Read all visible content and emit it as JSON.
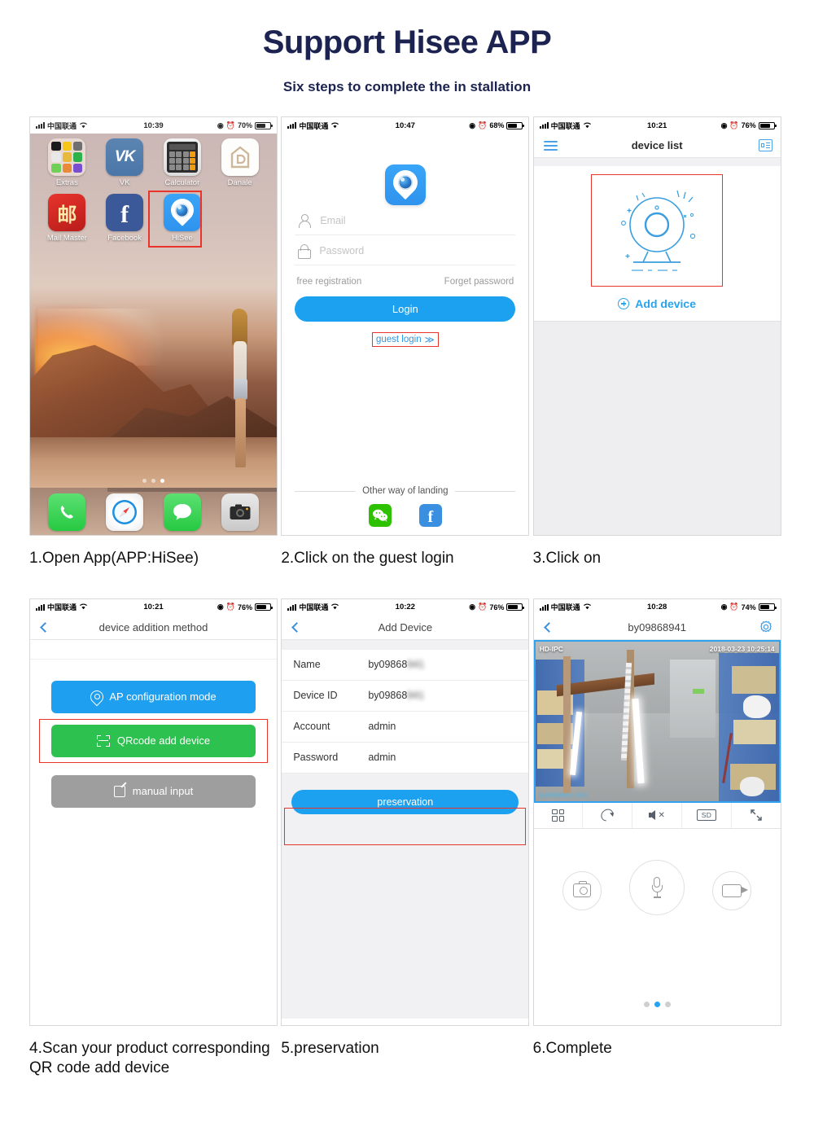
{
  "header": {
    "title": "Support Hisee APP",
    "subtitle": "Six steps to complete the in stallation"
  },
  "colors": {
    "title_navy": "#1c2350",
    "accent_blue": "#1ba1ef",
    "highlight_red": "#e8342a",
    "green": "#2dc14f",
    "gray_button": "#9e9e9e"
  },
  "steps": [
    {
      "caption": "1.Open App(APP:HiSee)"
    },
    {
      "caption": "2.Click on the guest login"
    },
    {
      "caption": "3.Click on"
    },
    {
      "caption": "4.Scan your product corresponding\n    QR code add device"
    },
    {
      "caption": "5.preservation"
    },
    {
      "caption": "6.Complete"
    }
  ],
  "phone1": {
    "status": {
      "carrier": "中国联通",
      "time": "10:39",
      "battery": "70%"
    },
    "apps": [
      {
        "label": "Extras",
        "icon": "folder-icon"
      },
      {
        "label": "VK",
        "icon": "vk-icon"
      },
      {
        "label": "Calculator",
        "icon": "calculator-icon"
      },
      {
        "label": "Danale",
        "icon": "danale-icon"
      },
      {
        "label": "Mail Master",
        "icon": "mail-master-icon"
      },
      {
        "label": "Facebook",
        "icon": "facebook-icon"
      },
      {
        "label": "HiSee",
        "icon": "hisee-icon"
      }
    ],
    "dock": [
      "phone-icon",
      "safari-icon",
      "messages-icon",
      "camera-icon"
    ]
  },
  "phone2": {
    "status": {
      "carrier": "中国联通",
      "time": "10:47",
      "battery": "68%"
    },
    "email_placeholder": "Email",
    "password_placeholder": "Password",
    "free_registration": "free registration",
    "forget_password": "Forget password",
    "login_label": "Login",
    "guest_login": "guest login",
    "guest_chevrons": "≫",
    "other_way": "Other way of landing",
    "socials": [
      "wechat-icon",
      "facebook-icon"
    ]
  },
  "phone3": {
    "status": {
      "carrier": "中国联通",
      "time": "10:21",
      "battery": "76%"
    },
    "nav_title": "device list",
    "add_device": "Add device"
  },
  "phone4": {
    "status": {
      "carrier": "中国联通",
      "time": "10:21",
      "battery": "76%"
    },
    "nav_title": "device addition method",
    "buttons": {
      "ap": "AP configuration mode",
      "qr": "QRcode add device",
      "manual": "manual input"
    }
  },
  "phone5": {
    "status": {
      "carrier": "中国联通",
      "time": "10:22",
      "battery": "76%"
    },
    "nav_title": "Add Device",
    "rows": [
      {
        "key": "Name",
        "value": "by09868",
        "blurred": "941"
      },
      {
        "key": "Device ID",
        "value": "by09868",
        "blurred": "941"
      },
      {
        "key": "Account",
        "value": "admin",
        "blurred": ""
      },
      {
        "key": "Password",
        "value": "admin",
        "blurred": ""
      }
    ],
    "save_label": "preservation"
  },
  "phone6": {
    "status": {
      "carrier": "中国联通",
      "time": "10:28",
      "battery": "74%"
    },
    "nav_title": "by09868941",
    "video": {
      "overlay_left": "HD-IPC",
      "overlay_right": "2018-03-23 10:25:14",
      "overlay_bottom": "by09868941 ch01"
    },
    "toolbar": [
      "grid-icon",
      "rotate-icon",
      "mute-icon",
      "SD",
      "fullscreen-icon"
    ],
    "sd_label": "SD",
    "controls": [
      "snapshot-icon",
      "microphone-icon",
      "record-icon"
    ],
    "page_dots": 3,
    "active_dot": 2
  }
}
